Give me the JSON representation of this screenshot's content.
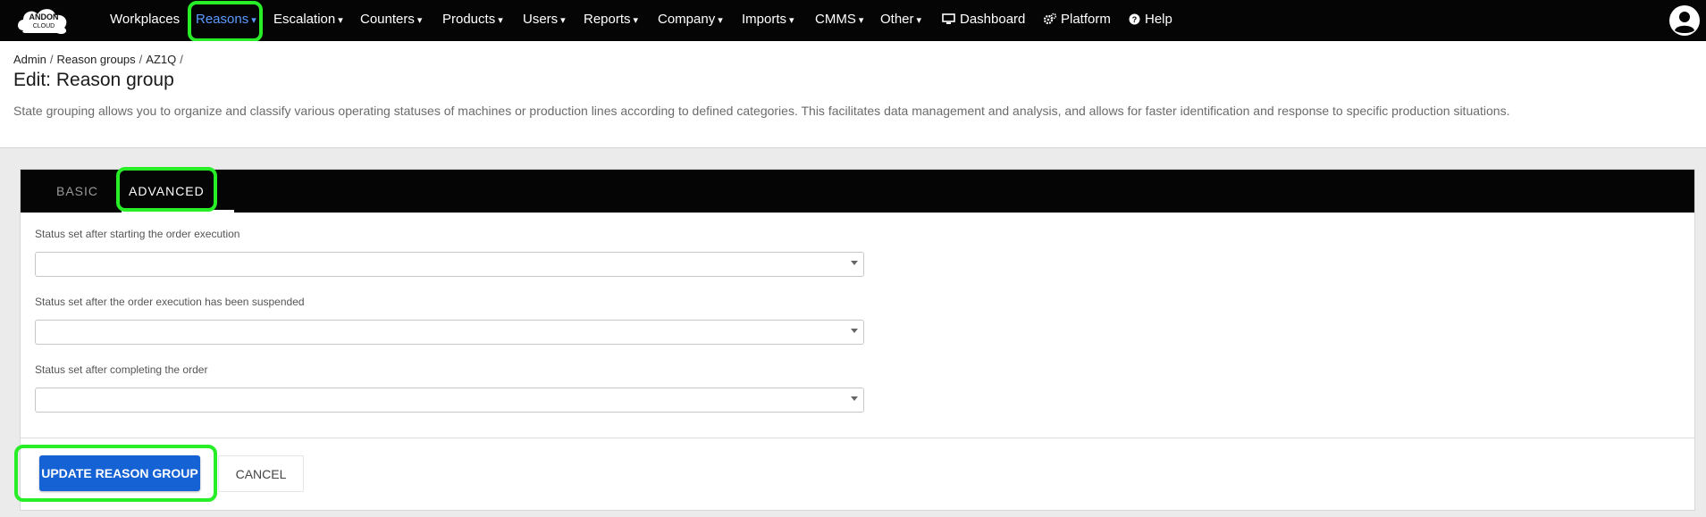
{
  "colors": {
    "navbar_bg": "#050505",
    "active_nav": "#5b9bff",
    "primary_button": "#1462d4",
    "highlight": "#27ee27"
  },
  "brand": {
    "logo_line1": "ANDON",
    "logo_line2": "CLOUD",
    "logo_icon": "cloud-logo-icon"
  },
  "nav": {
    "workplaces": "Workplaces",
    "reasons": "Reasons",
    "escalation": "Escalation",
    "counters": "Counters",
    "products": "Products",
    "users": "Users",
    "reports": "Reports",
    "company": "Company",
    "imports": "Imports",
    "cmms": "CMMS",
    "other": "Other",
    "dashboard": "Dashboard",
    "platform": "Platform",
    "help": "Help",
    "caret": "▾",
    "user_icon": "user-circle-icon"
  },
  "breadcrumb": {
    "admin": "Admin",
    "reason_groups": "Reason groups",
    "current": "AZ1Q",
    "separator": "/"
  },
  "page": {
    "title": "Edit: Reason group",
    "description": "State grouping allows you to organize and classify various operating statuses of machines or production lines according to defined categories. This facilitates data management and analysis, and allows for faster identification and response to specific production situations."
  },
  "tabs": {
    "basic": "BASIC",
    "advanced": "ADVANCED",
    "active": "advanced"
  },
  "form": {
    "field1_label": "Status set after starting the order execution",
    "field1_value": "",
    "field2_label": "Status set after the order execution has been suspended",
    "field2_value": "",
    "field3_label": "Status set after completing the order",
    "field3_value": ""
  },
  "actions": {
    "update": "UPDATE REASON GROUP",
    "cancel": "CANCEL"
  }
}
